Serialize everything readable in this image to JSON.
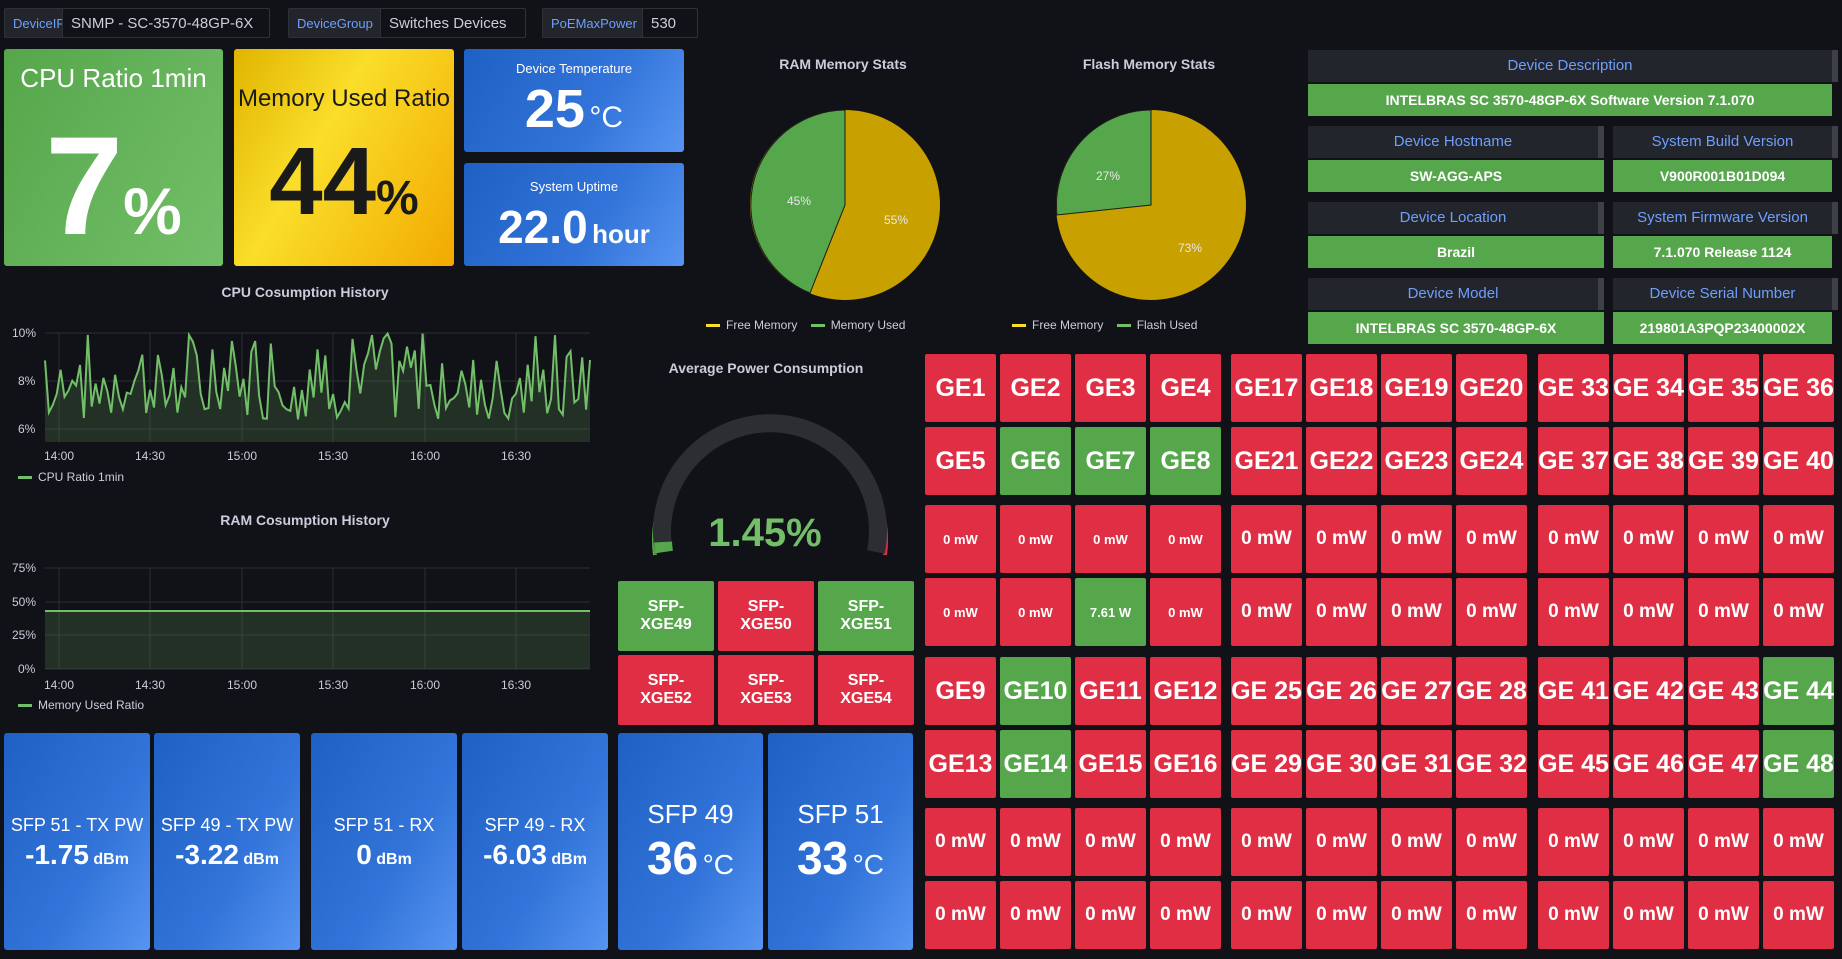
{
  "vars": [
    {
      "label": "DeviceIP",
      "value": "SNMP - SC-3570-48GP-6X ⌄"
    },
    {
      "label": "DeviceGroup",
      "value": "Switches Devices ⌄"
    },
    {
      "label": "PoEMaxPower",
      "value": "530 ⌄"
    }
  ],
  "cpu": {
    "title": "CPU Ratio 1min",
    "value": "7",
    "unit": "%"
  },
  "mem": {
    "title": "Memory Used Ratio",
    "value": "44",
    "unit": "%"
  },
  "temp": {
    "title": "Device Temperature",
    "value": "25",
    "unit": "°C"
  },
  "uptime": {
    "title": "System Uptime",
    "value": "22.0",
    "unit": "hour"
  },
  "ram_pie": {
    "title": "RAM Memory Stats",
    "free_label": "45%",
    "used_label": "55%",
    "legend": [
      "Free Memory",
      "Memory Used"
    ]
  },
  "flash_pie": {
    "title": "Flash Memory Stats",
    "free_label": "73%",
    "used_label": "27%",
    "legend": [
      "Free Memory",
      "Flash Used"
    ]
  },
  "colors": {
    "green": "#56a64b",
    "red": "#e02f44",
    "yellow": "#c8a000",
    "blue": "#3274d9",
    "line": "#73bf69"
  },
  "info": {
    "desc_label": "Device Description",
    "desc": "INTELBRAS SC 3570-48GP-6X Software Version 7.1.070",
    "hostname_label": "Device Hostname",
    "hostname": "SW-AGG-APS",
    "build_label": "System Build Version",
    "build": "V900R001B01D094",
    "location_label": "Device Location",
    "location": "Brazil",
    "firmware_label": "System Firmware Version",
    "firmware": "7.1.070 Release 1124",
    "model_label": "Device Model",
    "model": "INTELBRAS SC 3570-48GP-6X",
    "serial_label": "Device Serial Number",
    "serial": "219801A3PQP23400002X"
  },
  "cpu_history": {
    "title": "CPU Cosumption History",
    "legend": "CPU Ratio 1min",
    "yticks": [
      "10%",
      "8%",
      "6%"
    ],
    "xticks": [
      "14:00",
      "14:30",
      "15:00",
      "15:30",
      "16:00",
      "16:30"
    ]
  },
  "ram_history": {
    "title": "RAM Cosumption History",
    "legend": "Memory Used Ratio",
    "yticks": [
      "75%",
      "50%",
      "25%",
      "0%"
    ],
    "xticks": [
      "14:00",
      "14:30",
      "15:00",
      "15:30",
      "16:00",
      "16:30"
    ]
  },
  "power": {
    "title": "Average Power Consumption",
    "value": "1.45%"
  },
  "sfp_ports": [
    {
      "label": "SFP-XGE49",
      "status": "up"
    },
    {
      "label": "SFP-XGE50",
      "status": "down"
    },
    {
      "label": "SFP-XGE51",
      "status": "up"
    },
    {
      "label": "SFP-XGE52",
      "status": "down"
    },
    {
      "label": "SFP-XGE53",
      "status": "down"
    },
    {
      "label": "SFP-XGE54",
      "status": "down"
    }
  ],
  "bottom_stats": [
    {
      "title": "SFP 51 - TX PW",
      "value": "-1.75",
      "unit": "dBm"
    },
    {
      "title": "SFP 49 - TX PW",
      "value": "-3.22",
      "unit": "dBm"
    },
    {
      "title": "SFP 51 - RX",
      "value": "0",
      "unit": "dBm"
    },
    {
      "title": "SFP 49 - RX",
      "value": "-6.03",
      "unit": "dBm"
    }
  ],
  "sfp_temps": [
    {
      "title": "SFP 49",
      "value": "36",
      "unit": "°C"
    },
    {
      "title": "SFP 51",
      "value": "33",
      "unit": "°C"
    }
  ],
  "grid": {
    "rows": [
      [
        "GE1",
        "GE2",
        "GE3",
        "GE4",
        "GE17",
        "GE18",
        "GE19",
        "GE20",
        "GE 33",
        "GE 34",
        "GE 35",
        "GE 36"
      ],
      [
        "GE5",
        "GE6",
        "GE7",
        "GE8",
        "GE21",
        "GE22",
        "GE23",
        "GE24",
        "GE 37",
        "GE 38",
        "GE 39",
        "GE 40"
      ],
      [
        "0 mW",
        "0 mW",
        "0 mW",
        "0 mW",
        "0 mW",
        "0 mW",
        "0 mW",
        "0 mW",
        "0 mW",
        "0 mW",
        "0 mW",
        "0 mW"
      ],
      [
        "0 mW",
        "0 mW",
        "7.61 W",
        "0 mW",
        "0 mW",
        "0 mW",
        "0 mW",
        "0 mW",
        "0 mW",
        "0 mW",
        "0 mW",
        "0 mW"
      ],
      [
        "GE9",
        "GE10",
        "GE11",
        "GE12",
        "GE 25",
        "GE 26",
        "GE 27",
        "GE 28",
        "GE 41",
        "GE 42",
        "GE 43",
        "GE 44"
      ],
      [
        "GE13",
        "GE14",
        "GE15",
        "GE16",
        "GE 29",
        "GE 30",
        "GE 31",
        "GE 32",
        "GE 45",
        "GE 46",
        "GE 47",
        "GE 48"
      ],
      [
        "0 mW",
        "0 mW",
        "0 mW",
        "0 mW",
        "0 mW",
        "0 mW",
        "0 mW",
        "0 mW",
        "0 mW",
        "0 mW",
        "0 mW",
        "0 mW"
      ],
      [
        "0 mW",
        "0 mW",
        "0 mW",
        "0 mW",
        "0 mW",
        "0 mW",
        "0 mW",
        "0 mW",
        "0 mW",
        "0 mW",
        "0 mW",
        "0 mW"
      ]
    ],
    "status": [
      [
        "down",
        "down",
        "down",
        "down",
        "down",
        "down",
        "down",
        "down",
        "down",
        "down",
        "down",
        "down"
      ],
      [
        "down",
        "up",
        "up",
        "up",
        "down",
        "down",
        "down",
        "down",
        "down",
        "down",
        "down",
        "down"
      ],
      [
        "down",
        "down",
        "down",
        "down",
        "down",
        "down",
        "down",
        "down",
        "down",
        "down",
        "down",
        "down"
      ],
      [
        "down",
        "down",
        "up",
        "down",
        "down",
        "down",
        "down",
        "down",
        "down",
        "down",
        "down",
        "down"
      ],
      [
        "down",
        "up",
        "down",
        "down",
        "down",
        "down",
        "down",
        "down",
        "down",
        "down",
        "down",
        "up"
      ],
      [
        "down",
        "up",
        "down",
        "down",
        "down",
        "down",
        "down",
        "down",
        "down",
        "down",
        "down",
        "up"
      ],
      [
        "down",
        "down",
        "down",
        "down",
        "down",
        "down",
        "down",
        "down",
        "down",
        "down",
        "down",
        "down"
      ],
      [
        "down",
        "down",
        "down",
        "down",
        "down",
        "down",
        "down",
        "down",
        "down",
        "down",
        "down",
        "down"
      ]
    ]
  }
}
